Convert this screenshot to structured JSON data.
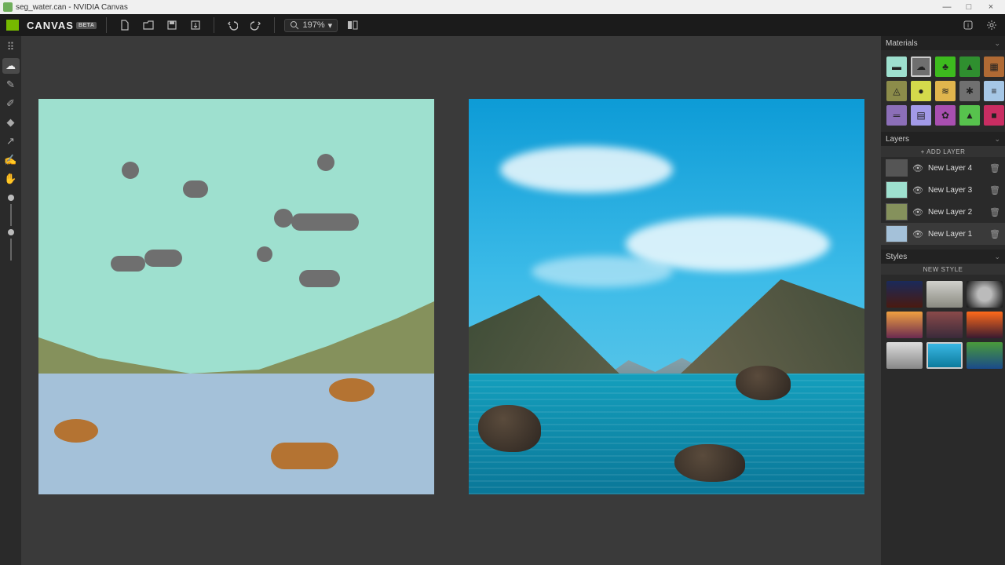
{
  "window": {
    "title": "seg_water.can - NVIDIA Canvas"
  },
  "os_buttons": {
    "min": "—",
    "max": "□",
    "close": "×"
  },
  "brand": {
    "name": "CANVAS",
    "tag": "BETA"
  },
  "toolbar": {
    "zoom": "197%",
    "zoom_caret": "▾"
  },
  "panels": {
    "materials": {
      "title": "Materials"
    },
    "layers": {
      "title": "Layers",
      "add": "+ ADD LAYER"
    },
    "styles": {
      "title": "Styles",
      "new": "NEW STYLE"
    }
  },
  "materials": [
    {
      "name": "sky",
      "bg": "#9ee0cf",
      "glyph": "▬"
    },
    {
      "name": "cloud",
      "bg": "#6f6f6f",
      "glyph": "☁",
      "selected": true
    },
    {
      "name": "grass",
      "bg": "#3dbb1e",
      "glyph": "♣"
    },
    {
      "name": "mountain",
      "bg": "#2f8f2f",
      "glyph": "▲"
    },
    {
      "name": "dirt",
      "bg": "#b06a34",
      "glyph": "▦"
    },
    {
      "name": "hill",
      "bg": "#8c8c4a",
      "glyph": "◬"
    },
    {
      "name": "bush",
      "bg": "#d4d94b",
      "glyph": "●"
    },
    {
      "name": "sand",
      "bg": "#e0b54d",
      "glyph": "≋"
    },
    {
      "name": "gravel",
      "bg": "#707070",
      "glyph": "✱"
    },
    {
      "name": "snow",
      "bg": "#a6c7e6",
      "glyph": "≡"
    },
    {
      "name": "fog",
      "bg": "#8c6fb8",
      "glyph": "═"
    },
    {
      "name": "sea",
      "bg": "#a29ae8",
      "glyph": "▤"
    },
    {
      "name": "flower",
      "bg": "#a84fb0",
      "glyph": "✿"
    },
    {
      "name": "tree",
      "bg": "#57c24d",
      "glyph": "▲"
    },
    {
      "name": "rock",
      "bg": "#c92d62",
      "glyph": "■"
    }
  ],
  "layers": [
    {
      "label": "New Layer 4",
      "thumb": "#555"
    },
    {
      "label": "New Layer 3",
      "thumb": "#9ee0cf"
    },
    {
      "label": "New Layer 2",
      "thumb": "#85915c"
    },
    {
      "label": "New Layer 1",
      "thumb": "#a4c1d9",
      "selected": true
    }
  ],
  "styles": [
    {
      "bg": "linear-gradient(#1a2a5a,#4a1a10)"
    },
    {
      "bg": "linear-gradient(#d0d0cc,#8a8a80)"
    },
    {
      "bg": "radial-gradient(circle,#bbb 30%,#111)"
    },
    {
      "bg": "linear-gradient(#f0a040,#6a2a50)"
    },
    {
      "bg": "linear-gradient(#8a4a4a,#3a2a3a)"
    },
    {
      "bg": "linear-gradient(#ff6a1a,#3a1a30)"
    },
    {
      "bg": "linear-gradient(#dcdcdc,#888)"
    },
    {
      "bg": "linear-gradient(#3cbbe8,#0a7798)",
      "selected": true
    },
    {
      "bg": "linear-gradient(#4a9a3a,#1a4a8a)"
    }
  ]
}
